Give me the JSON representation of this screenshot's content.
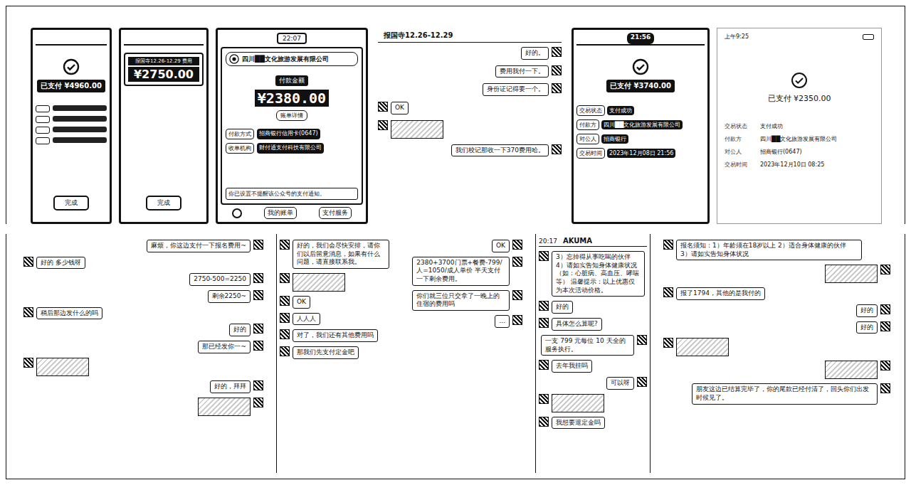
{
  "top_row": [
    {
      "kind": "paid",
      "time": "",
      "amount": "已支付 ¥4960.00",
      "rows": [],
      "button": "完成"
    },
    {
      "kind": "pay",
      "caption": "报国寺12.26-12.29 费用",
      "amount": "¥2750.00",
      "button": "完成"
    },
    {
      "kind": "bill",
      "time": "22:07",
      "company": "四川██文化旅游发展有限公司",
      "amount_label": "付款金额",
      "amount": "¥2380.00",
      "detail": "账单详情",
      "rows": [
        {
          "label": "付款方式",
          "value": "招商银行信用卡(0647)"
        },
        {
          "label": "收单机构",
          "value": "财付通支付科技有限公司"
        }
      ],
      "notice": "你已设置不提醒该公众号的支付通知。",
      "footer": [
        "我的账单",
        "支付服务"
      ]
    },
    {
      "kind": "chat",
      "title": "报国寺12.26-12.29",
      "time": "",
      "messages": [
        {
          "side": "right",
          "kind": "text",
          "text": "好的。"
        },
        {
          "side": "right",
          "kind": "text",
          "text": "费用我付一下。"
        },
        {
          "side": "right",
          "kind": "text",
          "text": "身份证记得要一个。"
        },
        {
          "side": "left",
          "kind": "text",
          "text": "OK"
        },
        {
          "side": "left",
          "kind": "image",
          "text": ""
        },
        {
          "side": "right",
          "kind": "text",
          "text": "我们校记那收一下370费用哈。"
        }
      ]
    },
    {
      "kind": "paid",
      "time": "21:56",
      "amount": "已支付 ¥3740.00",
      "rows": [
        {
          "label": "交易状态",
          "value": "支付成功"
        },
        {
          "label": "付款方",
          "value": "四川██文化旅游发展有限公司"
        },
        {
          "label": "对公人",
          "value": "招商银行"
        },
        {
          "label": "交易时间",
          "value": "2023年12月08日 21:56"
        }
      ],
      "button": ""
    },
    {
      "kind": "receipt",
      "time": "上午9:25",
      "amount": "已支付 ¥2350.00",
      "rows": [
        {
          "label": "交易状态",
          "value": "支付成功"
        },
        {
          "label": "付款方",
          "value": "四川██文化旅游发展有限公司"
        },
        {
          "label": "对公人",
          "value": "招商银行(0647)"
        },
        {
          "label": "交易时间",
          "value": "2023年12月10日 08:25"
        }
      ]
    }
  ],
  "bottom_row": [
    {
      "kind": "chat",
      "title": "",
      "time": "",
      "messages": [
        {
          "side": "right",
          "kind": "text",
          "text": "麻烦，你这边支付一下报名费用~"
        },
        {
          "side": "left",
          "kind": "text",
          "text": "好的 多少钱呀"
        },
        {
          "side": "right",
          "kind": "text",
          "text": "2750-500=2250"
        },
        {
          "side": "right",
          "kind": "text",
          "text": "剩余2250~"
        },
        {
          "side": "left",
          "kind": "text",
          "text": "稍后那边发什么的吗"
        },
        {
          "side": "right",
          "kind": "text",
          "text": "好的"
        },
        {
          "side": "right",
          "kind": "text",
          "text": "那已经发你一~"
        },
        {
          "side": "left",
          "kind": "image",
          "text": ""
        },
        {
          "side": "right",
          "kind": "text",
          "text": "好的，拜拜"
        },
        {
          "side": "right",
          "kind": "image",
          "text": ""
        }
      ]
    },
    {
      "kind": "chat",
      "title": "",
      "time": "",
      "messages": [
        {
          "side": "left",
          "kind": "text",
          "text": "好的，我们会尽快安排，请你们以后留意消息，如果有什么问题，请直接联系我。"
        },
        {
          "side": "left",
          "kind": "image",
          "text": ""
        },
        {
          "side": "left",
          "kind": "text",
          "text": "OK"
        },
        {
          "side": "left",
          "kind": "text",
          "text": "人人人"
        },
        {
          "side": "left",
          "kind": "text",
          "text": "对了，我们还有其他费用吗"
        },
        {
          "side": "left",
          "kind": "text",
          "text": "那我们先支付定金吧"
        }
      ]
    },
    {
      "kind": "chat",
      "title": "",
      "time": "",
      "messages": [
        {
          "side": "right",
          "kind": "text",
          "text": "OK"
        },
        {
          "side": "right",
          "kind": "text",
          "text": "2380+3700门票+餐费-799/人=1050/成人单价 半天支付一下剩余费用。"
        },
        {
          "side": "right",
          "kind": "text",
          "text": "你们就三位只交拿了一晚上的住宿的费用吗"
        },
        {
          "side": "right",
          "kind": "text",
          "text": "..."
        }
      ]
    },
    {
      "kind": "chat",
      "title": "AKUMA",
      "time": "20:17",
      "messages": [
        {
          "side": "left",
          "kind": "text",
          "text": "3）忘掉得从事吃喝的伙伴 4）请如实告知身体健康状况（如：心脏病、高血压、哮喘等） 温馨提示：以上优惠仅为本次活动价格。"
        },
        {
          "side": "left",
          "kind": "text",
          "text": "好的"
        },
        {
          "side": "left",
          "kind": "text",
          "text": "具体怎么算呢?"
        },
        {
          "side": "right",
          "kind": "text",
          "text": "一支 799 元每位 10 天全的服务执行。"
        },
        {
          "side": "left",
          "kind": "text",
          "text": "去年我挂吗"
        },
        {
          "side": "right",
          "kind": "text",
          "text": "可以呀"
        },
        {
          "side": "left",
          "kind": "image",
          "text": ""
        },
        {
          "side": "left",
          "kind": "text",
          "text": "我想要退定金吗"
        }
      ]
    },
    {
      "kind": "chat",
      "title": "",
      "time": "",
      "messages": [
        {
          "side": "left",
          "kind": "text",
          "text": "报名须知：1）年龄须在18岁以上 2）适合身体健康的伙伴 3）请如实告知身体状况"
        },
        {
          "side": "right",
          "kind": "image",
          "text": ""
        },
        {
          "side": "left",
          "kind": "text",
          "text": "报了1794，其他的是我付的"
        },
        {
          "side": "right",
          "kind": "text",
          "text": "好的"
        },
        {
          "side": "right",
          "kind": "text",
          "text": "好的"
        },
        {
          "side": "left",
          "kind": "image",
          "text": ""
        },
        {
          "side": "right",
          "kind": "image",
          "text": ""
        },
        {
          "side": "right",
          "kind": "text",
          "text": "朋友这边已结算完毕了，你的尾款已经付清了，回头你们出发时候见了。"
        }
      ]
    }
  ]
}
